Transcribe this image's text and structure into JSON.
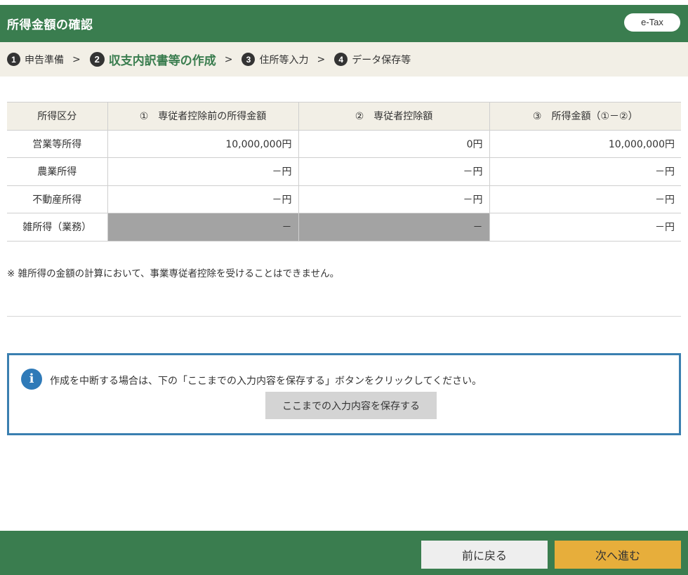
{
  "header": {
    "title": "所得金額の確認",
    "badge": "e-Tax"
  },
  "steps": [
    {
      "num": "1",
      "label": "申告準備"
    },
    {
      "num": "2",
      "label": "収支内訳書等の作成"
    },
    {
      "num": "3",
      "label": "住所等入力"
    },
    {
      "num": "4",
      "label": "データ保存等"
    }
  ],
  "step_separator": ">",
  "table": {
    "headers": [
      "所得区分",
      "①　専従者控除前の所得金額",
      "②　専従者控除額",
      "③　所得金額（①－②）"
    ],
    "rows": [
      {
        "category": "営業等所得",
        "before": "10,000,000円",
        "deduction": "0円",
        "income": "10,000,000円"
      },
      {
        "category": "農業所得",
        "before": "－円",
        "deduction": "－円",
        "income": "－円"
      },
      {
        "category": "不動産所得",
        "before": "－円",
        "deduction": "－円",
        "income": "－円"
      },
      {
        "category": "雑所得（業務）",
        "before": "－",
        "deduction": "－",
        "income": "－円"
      }
    ]
  },
  "note": "※ 雑所得の金額の計算において、事業専従者控除を受けることはできません。",
  "info": {
    "icon": "i",
    "text": "作成を中断する場合は、下の「ここまでの入力内容を保存する」ボタンをクリックしてください。",
    "save_button": "ここまでの入力内容を保存する"
  },
  "footer": {
    "back_label": "前に戻る",
    "next_label": "次へ進む"
  },
  "colors": {
    "header_green": "#3a7d4f",
    "step_bg": "#f2efe6",
    "info_blue": "#2f7ab8",
    "next_orange": "#e7ae3b"
  }
}
